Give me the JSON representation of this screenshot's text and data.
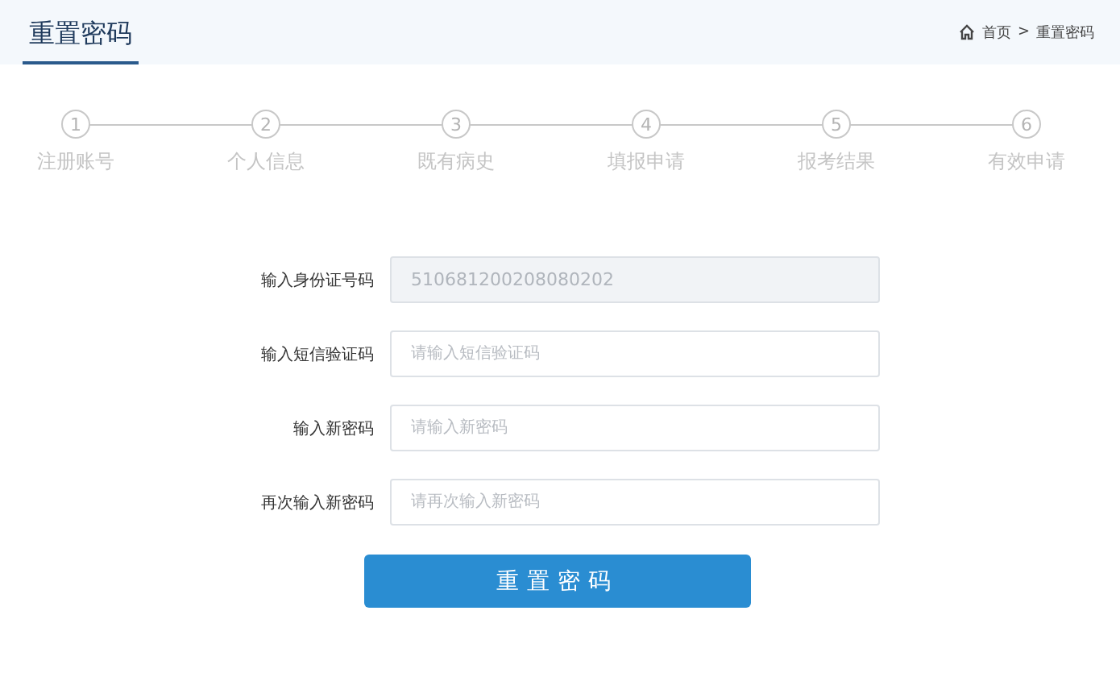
{
  "header": {
    "tab": "重置密码",
    "breadcrumb": {
      "home": "首页",
      "separator": ">",
      "current": "重置密码"
    }
  },
  "steps": [
    {
      "number": "1",
      "label": "注册账号"
    },
    {
      "number": "2",
      "label": "个人信息"
    },
    {
      "number": "3",
      "label": "既有病史"
    },
    {
      "number": "4",
      "label": "填报申请"
    },
    {
      "number": "5",
      "label": "报考结果"
    },
    {
      "number": "6",
      "label": "有效申请"
    }
  ],
  "form": {
    "fields": [
      {
        "label": "输入身份证号码",
        "value": "510681200208080202",
        "disabled": true
      },
      {
        "label": "输入短信验证码",
        "placeholder": "请输入短信验证码",
        "disabled": false
      },
      {
        "label": "输入新密码",
        "placeholder": "请输入新密码",
        "disabled": false
      },
      {
        "label": "再次输入新密码",
        "placeholder": "请再次输入新密码",
        "disabled": false
      }
    ],
    "submit": "重置密码"
  }
}
